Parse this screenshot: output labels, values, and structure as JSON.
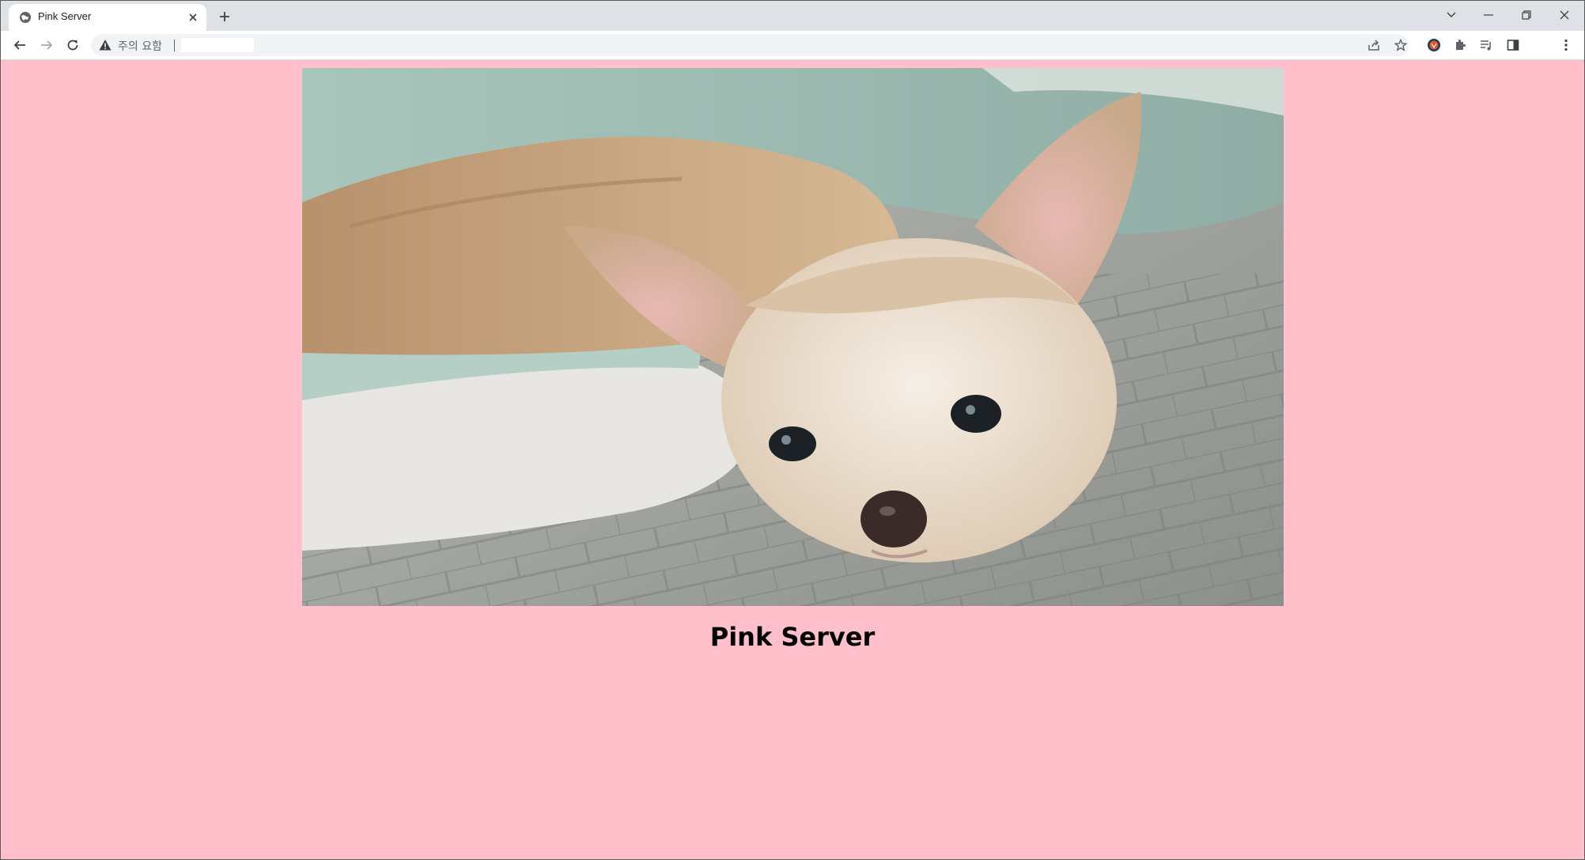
{
  "browser": {
    "tab": {
      "title": "Pink Server",
      "favicon": "globe-icon",
      "close_icon": "close-icon"
    },
    "new_tab_icon": "plus-icon",
    "window_controls": [
      "chevron-down-icon",
      "minimize-icon",
      "restore-icon",
      "close-icon"
    ],
    "toolbar": {
      "back_icon": "arrow-left-icon",
      "forward_icon": "arrow-right-icon",
      "reload_icon": "reload-icon",
      "security_icon": "warning-icon",
      "security_label": "주의 요함",
      "url": "",
      "actions": [
        "share-icon",
        "star-icon",
        "extension-avatar-icon",
        "puzzle-icon",
        "media-queue-icon",
        "side-panel-icon",
        "kebab-menu-icon"
      ]
    }
  },
  "page": {
    "background_color": "#ffc0cb",
    "photo": {
      "subject": "chihuahua lying on a bed",
      "icon": "photo-image"
    },
    "heading": "Pink Server"
  }
}
